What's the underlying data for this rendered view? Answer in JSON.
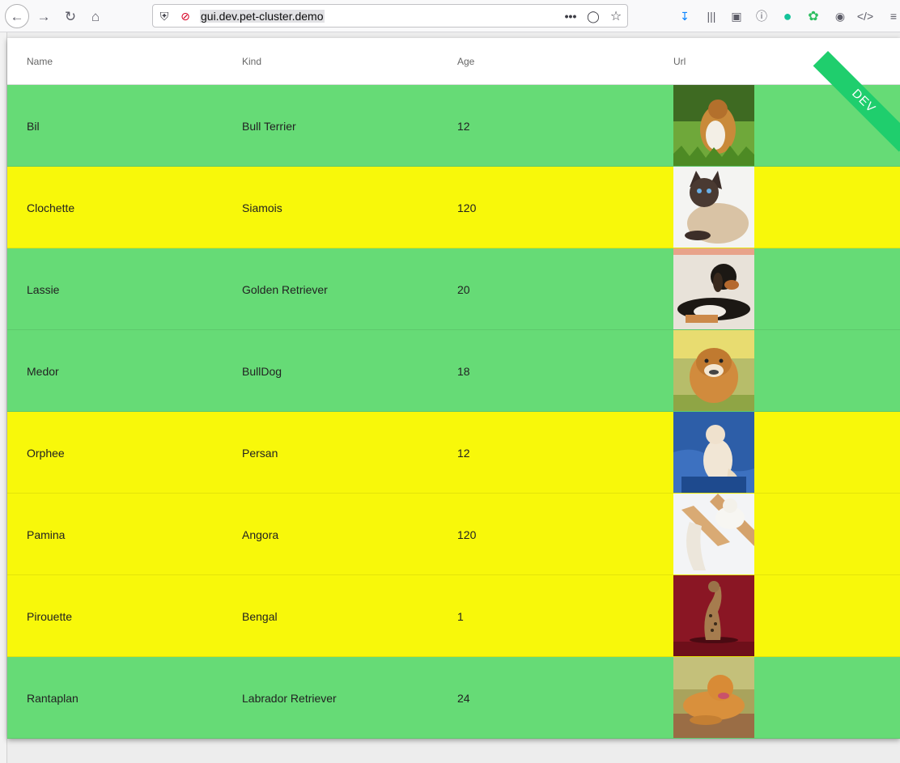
{
  "browser": {
    "url": "gui.dev.pet-cluster.demo",
    "icons": [
      "back-icon",
      "forward-icon",
      "reload-icon",
      "home-icon",
      "shield-icon",
      "insecure-lock-icon",
      "more-icon",
      "pocket-icon",
      "star-icon",
      "download-icon",
      "library-icon",
      "sidebar-icon",
      "reader-icon",
      "grammarly-icon",
      "evernote-icon",
      "account-icon",
      "devtools-icon",
      "menu-icon"
    ]
  },
  "table": {
    "headers": {
      "name": "Name",
      "kind": "Kind",
      "age": "Age",
      "url": "Url"
    },
    "rows": [
      {
        "name": "Bil",
        "kind": "Bull Terrier",
        "age": "12",
        "color": "#66db76",
        "image": "collie-dog-photo"
      },
      {
        "name": "Clochette",
        "kind": "Siamois",
        "age": "120",
        "color": "#f8f80a",
        "image": "siamese-cat-photo"
      },
      {
        "name": "Lassie",
        "kind": "Golden Retriever",
        "age": "20",
        "color": "#66db76",
        "image": "beagle-dog-photo"
      },
      {
        "name": "Medor",
        "kind": "BullDog",
        "age": "18",
        "color": "#66db76",
        "image": "bulldog-photo"
      },
      {
        "name": "Orphee",
        "kind": "Persan",
        "age": "12",
        "color": "#f8f80a",
        "image": "persian-cat-photo"
      },
      {
        "name": "Pamina",
        "kind": "Angora",
        "age": "120",
        "color": "#f8f80a",
        "image": "angora-cat-photo"
      },
      {
        "name": "Pirouette",
        "kind": "Bengal",
        "age": "1",
        "color": "#f8f80a",
        "image": "bengal-cat-photo"
      },
      {
        "name": "Rantaplan",
        "kind": "Labrador Retriever",
        "age": "24",
        "color": "#66db76",
        "image": "golden-retriever-photo"
      }
    ]
  },
  "ribbon": {
    "label": "DEV",
    "color": "#1fce6d"
  }
}
